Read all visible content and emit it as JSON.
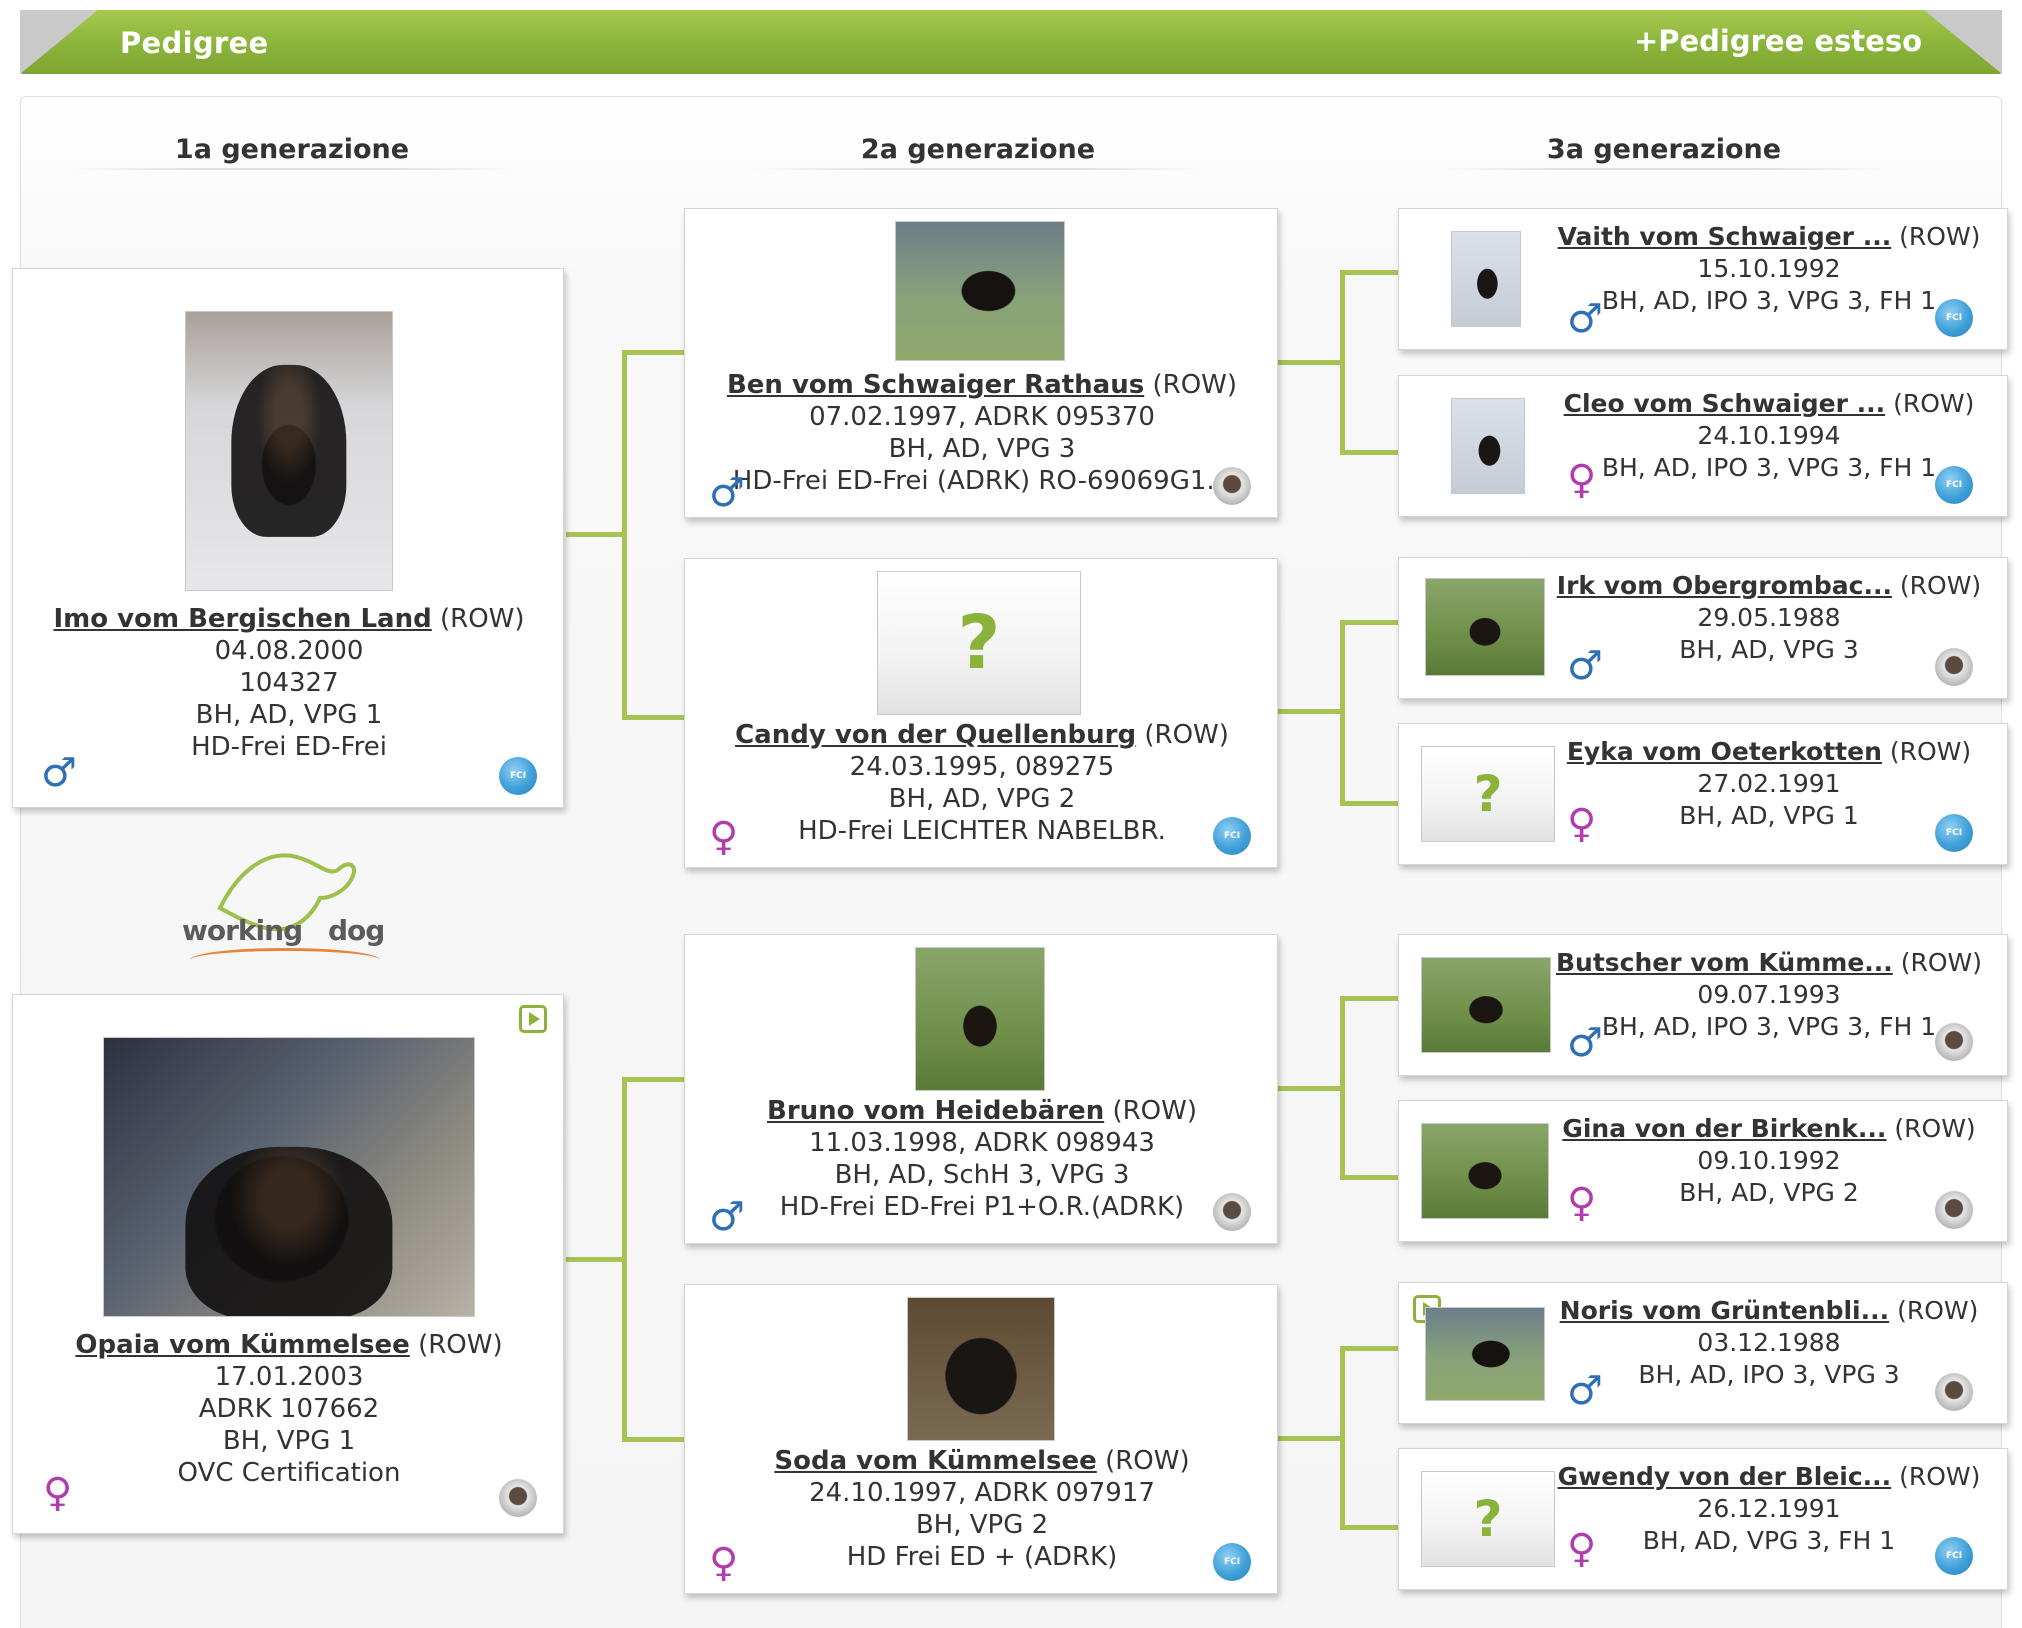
{
  "header": {
    "title": "Pedigree",
    "extended_link": "+Pedigree esteso"
  },
  "generations": [
    {
      "label": "1a generazione"
    },
    {
      "label": "2a generazione"
    },
    {
      "label": "3a generazione"
    }
  ],
  "logo": {
    "word1": "working",
    "word2": "dog"
  },
  "gen1": [
    {
      "name": "Imo vom Bergischen Land",
      "reg": "(ROW)",
      "lines": [
        "04.08.2000",
        "104327",
        "BH, AD, VPG 1",
        "HD-Frei ED-Frei"
      ],
      "sex_icon": "male-icon",
      "sex_symbol": "♂",
      "badge": "fci-badge-icon",
      "badge_text": "FCI"
    },
    {
      "name": "Opaia vom Kümmelsee",
      "reg": "(ROW)",
      "lines": [
        "17.01.2003",
        "ADRK 107662",
        "BH, VPG 1",
        "OVC Certification"
      ],
      "sex_icon": "female-icon",
      "sex_symbol": "♀",
      "badge": "seal-badge-icon"
    }
  ],
  "gen2": [
    {
      "name": "Ben vom Schwaiger Rathaus",
      "reg": "(ROW)",
      "lines": [
        "07.02.1997, ADRK 095370",
        "BH, AD, VPG 3",
        "HD-Frei ED-Frei (ADRK) RO-69069G1..."
      ],
      "sex_icon": "male-icon",
      "sex_symbol": "♂",
      "badge": "seal-badge-icon"
    },
    {
      "name": "Candy von der Quellenburg",
      "reg": "(ROW)",
      "lines": [
        "24.03.1995, 089275",
        "BH, AD, VPG 2",
        "HD-Frei LEICHTER NABELBR."
      ],
      "sex_icon": "female-icon",
      "sex_symbol": "♀",
      "badge": "fci-badge-icon",
      "badge_text": "FCI"
    },
    {
      "name": "Bruno vom Heidebären",
      "reg": "(ROW)",
      "lines": [
        "11.03.1998, ADRK 098943",
        "BH, AD, SchH 3, VPG 3",
        "HD-Frei ED-Frei P1+O.R.(ADRK)"
      ],
      "sex_icon": "male-icon",
      "sex_symbol": "♂",
      "badge": "seal-badge-icon"
    },
    {
      "name": "Soda vom Kümmelsee",
      "reg": "(ROW)",
      "lines": [
        "24.10.1997, ADRK 097917",
        "BH, VPG 2",
        "HD Frei ED + (ADRK)"
      ],
      "sex_icon": "female-icon",
      "sex_symbol": "♀",
      "badge": "fci-badge-icon",
      "badge_text": "FCI"
    }
  ],
  "gen3": [
    {
      "name": "Vaith vom Schwaiger ...",
      "reg": "(ROW)",
      "lines": [
        "15.10.1992",
        "BH, AD, IPO 3, VPG 3, FH 1"
      ],
      "sex_icon": "male-icon",
      "sex_symbol": "♂",
      "badge": "fci-badge-icon",
      "badge_text": "FCI"
    },
    {
      "name": "Cleo vom Schwaiger ...",
      "reg": "(ROW)",
      "lines": [
        "24.10.1994",
        "BH, AD, IPO 3, VPG 3, FH 1"
      ],
      "sex_icon": "female-icon",
      "sex_symbol": "♀",
      "badge": "fci-badge-icon",
      "badge_text": "FCI"
    },
    {
      "name": "Irk vom Obergrombac...",
      "reg": "(ROW)",
      "lines": [
        "29.05.1988",
        "BH, AD, VPG 3"
      ],
      "sex_icon": "male-icon",
      "sex_symbol": "♂",
      "badge": "seal-badge-icon"
    },
    {
      "name": "Eyka vom Oeterkotten",
      "reg": "(ROW)",
      "lines": [
        "27.02.1991",
        "BH, AD, VPG 1"
      ],
      "sex_icon": "female-icon",
      "sex_symbol": "♀",
      "badge": "fci-badge-icon",
      "badge_text": "FCI"
    },
    {
      "name": "Butscher vom Kümme...",
      "reg": "(ROW)",
      "lines": [
        "09.07.1993",
        "BH, AD, IPO 3, VPG 3, FH 1"
      ],
      "sex_icon": "male-icon",
      "sex_symbol": "♂",
      "badge": "seal-badge-icon"
    },
    {
      "name": "Gina von der Birkenk...",
      "reg": "(ROW)",
      "lines": [
        "09.10.1992",
        "BH, AD, VPG 2"
      ],
      "sex_icon": "female-icon",
      "sex_symbol": "♀",
      "badge": "seal-badge-icon"
    },
    {
      "name": "Noris vom Grüntenbli...",
      "reg": "(ROW)",
      "lines": [
        "03.12.1988",
        "BH, AD, IPO 3, VPG 3"
      ],
      "sex_icon": "male-icon",
      "sex_symbol": "♂",
      "badge": "seal-badge-icon"
    },
    {
      "name": "Gwendy von der Bleic...",
      "reg": "(ROW)",
      "lines": [
        "26.12.1991",
        "BH, AD, VPG 3, FH 1"
      ],
      "sex_icon": "female-icon",
      "sex_symbol": "♀",
      "badge": "fci-badge-icon",
      "badge_text": "FCI"
    }
  ],
  "colors": {
    "accent_green": "#8ab43a",
    "connector_green": "#a7c354",
    "male_blue": "#2f6fb6",
    "female_purple": "#b13cad",
    "fci_blue": "#3f9fd8"
  }
}
